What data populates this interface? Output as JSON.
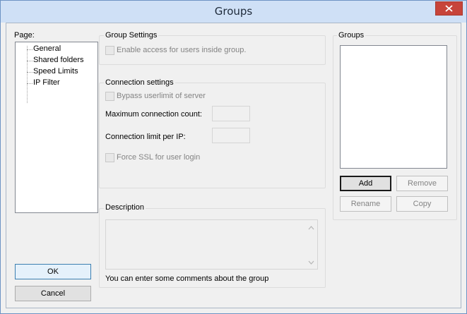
{
  "window": {
    "title": "Groups"
  },
  "page_panel": {
    "label": "Page:",
    "items": [
      "General",
      "Shared folders",
      "Speed Limits",
      "IP Filter"
    ]
  },
  "group_settings": {
    "title": "Group Settings",
    "enable_access_label": "Enable access for users inside group.",
    "enable_access_checked": false
  },
  "connection_settings": {
    "title": "Connection settings",
    "bypass_label": "Bypass userlimit of server",
    "bypass_checked": false,
    "max_conn_label": "Maximum connection count:",
    "max_conn_value": "",
    "limit_per_ip_label": "Connection limit per IP:",
    "limit_per_ip_value": "",
    "force_ssl_label": "Force SSL for user login",
    "force_ssl_checked": false
  },
  "description": {
    "title": "Description",
    "value": "",
    "hint": "You can enter some comments about the group"
  },
  "groups_panel": {
    "title": "Groups",
    "items": [],
    "add_label": "Add",
    "remove_label": "Remove",
    "rename_label": "Rename",
    "copy_label": "Copy"
  },
  "footer": {
    "ok_label": "OK",
    "cancel_label": "Cancel"
  },
  "colors": {
    "titlebar": "#cfe0f6",
    "close_button": "#c7443a",
    "dialog_bg": "#f0f0f0"
  }
}
